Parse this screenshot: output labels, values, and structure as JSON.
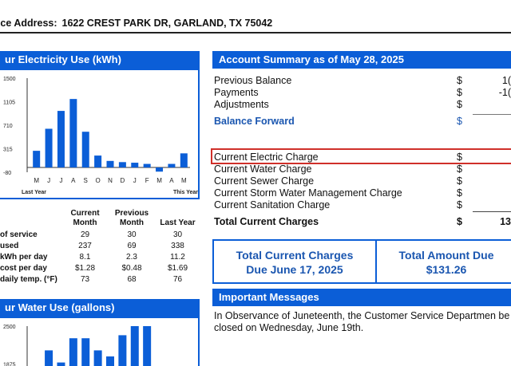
{
  "service_address": {
    "label": "vice Address:",
    "value": "1622 CREST PARK DR, GARLAND, TX 75042"
  },
  "electricity_panel": {
    "title": "ur Electricity Use (kWh)",
    "left_caption": "Last Year",
    "right_caption": "This Year"
  },
  "water_panel": {
    "title": "ur Water Use (gallons)"
  },
  "usage_table": {
    "headers": [
      "Current Month",
      "Previous Month",
      "Last Year"
    ],
    "rows": [
      {
        "label": "of service",
        "values": [
          "29",
          "30",
          "30"
        ]
      },
      {
        "label": "used",
        "values": [
          "237",
          "69",
          "338"
        ]
      },
      {
        "label": "kWh per day",
        "values": [
          "8.1",
          "2.3",
          "11.2"
        ]
      },
      {
        "label": "cost per day",
        "values": [
          "$1.28",
          "$0.48",
          "$1.69"
        ]
      },
      {
        "label": "daily temp. (°F)",
        "values": [
          "73",
          "68",
          "76"
        ]
      }
    ]
  },
  "account_summary": {
    "title": "Account Summary as of May 28, 2025",
    "rows": [
      {
        "label": "Previous Balance",
        "dollar": "$",
        "amount": "1("
      },
      {
        "label": "Payments",
        "dollar": "$",
        "amount": "-1("
      },
      {
        "label": "Adjustments",
        "dollar": "$",
        "amount": ""
      },
      {
        "label": "Balance Forward",
        "dollar": "$",
        "amount": ""
      },
      {
        "label": "Current Electric Charge",
        "dollar": "$",
        "amount": ""
      },
      {
        "label": "Current Water Charge",
        "dollar": "$",
        "amount": ""
      },
      {
        "label": "Current Sewer Charge",
        "dollar": "$",
        "amount": ""
      },
      {
        "label": "Current Storm Water Management Charge",
        "dollar": "$",
        "amount": ""
      },
      {
        "label": "Current Sanitation Charge",
        "dollar": "$",
        "amount": ""
      },
      {
        "label": "Total Current Charges",
        "dollar": "$",
        "amount": "13"
      }
    ]
  },
  "due_box": {
    "left_line1": "Total Current Charges",
    "left_line2": "Due June 17, 2025",
    "right_line1": "Total Amount Due",
    "right_line2": "$131.26"
  },
  "messages": {
    "title": "Important Messages",
    "body": "In Observance of Juneteenth, the Customer Service Departmen be closed on Wednesday, June 19th."
  },
  "colors": {
    "panel_blue": "#0b5ed7",
    "bar_blue": "#0b5ed7",
    "highlight_red": "#d0302a",
    "link_blue": "#1a56b0"
  },
  "chart_data": [
    {
      "type": "bar",
      "title": "ur Electricity Use (kWh)",
      "categories": [
        "M",
        "J",
        "J",
        "A",
        "S",
        "O",
        "N",
        "D",
        "J",
        "F",
        "M",
        "A",
        "M"
      ],
      "values": [
        280,
        650,
        950,
        1150,
        600,
        200,
        110,
        90,
        80,
        60,
        -70,
        60,
        237
      ],
      "yticks": [
        "1500",
        "1105",
        "710",
        "315",
        "-80"
      ],
      "ylim": [
        -80,
        1500
      ],
      "grid": false
    },
    {
      "type": "bar",
      "title": "ur Water Use (gallons)",
      "values": [
        1700,
        2100,
        1900,
        2300,
        2300,
        2100,
        2000,
        2350,
        2500,
        2500,
        1700,
        1700,
        1700
      ],
      "yticks": [
        "2500",
        "1875"
      ],
      "ylim": [
        0,
        2500
      ],
      "grid": false
    }
  ]
}
